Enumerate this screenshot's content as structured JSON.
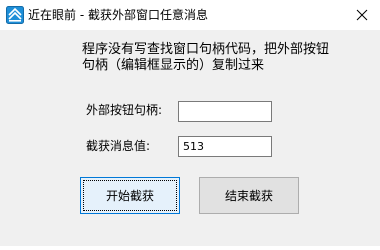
{
  "window": {
    "title": "近在眼前 - 截获外部窗口任意消息",
    "app_icon": "app-logo-icon",
    "close_icon": "close-icon"
  },
  "content": {
    "description": "程序没有写查找窗口句柄代码，把外部按钮句柄（编辑框显示的）复制过来",
    "handle_label": "外部按钮句柄:",
    "handle_value": "",
    "message_label": "截获消息值:",
    "message_value": "513"
  },
  "buttons": {
    "start_label": "开始截获",
    "stop_label": "结束截获"
  },
  "colors": {
    "accent": "#0078d7",
    "client_bg": "#f0f0f0"
  }
}
